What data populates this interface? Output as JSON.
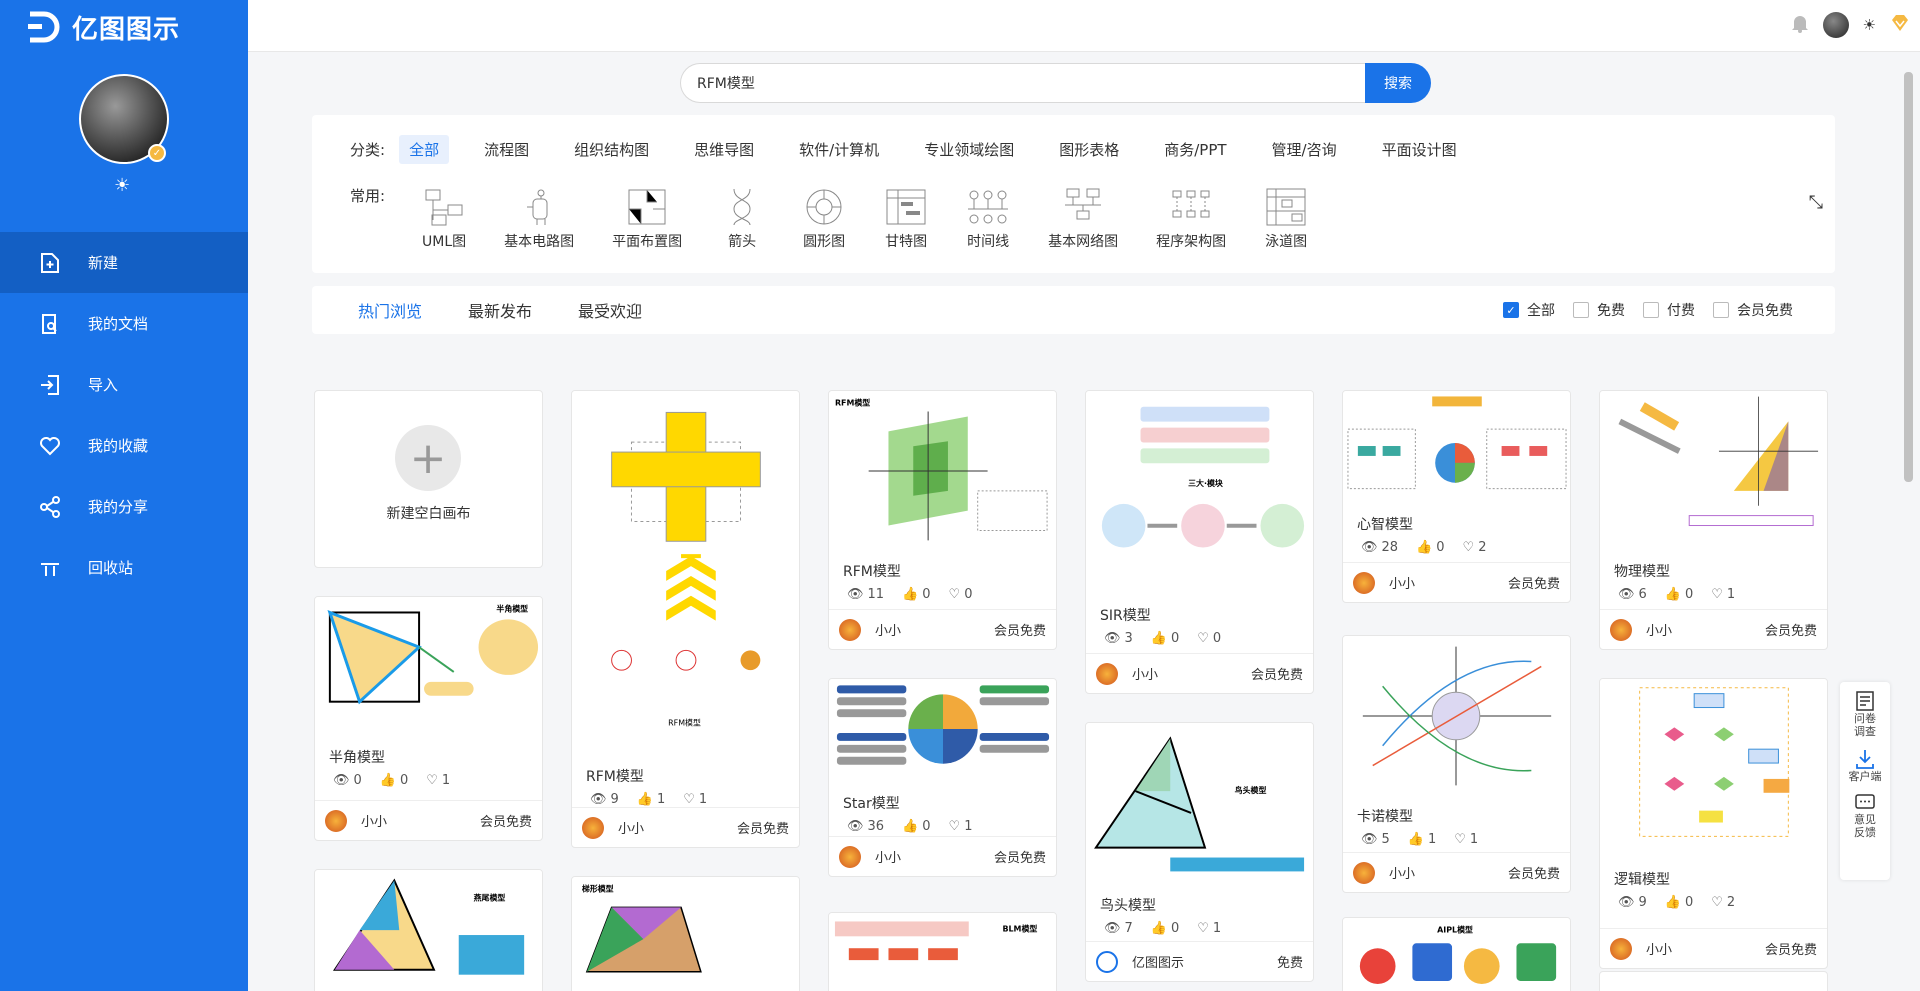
{
  "app": {
    "name": "亿图图示"
  },
  "sidebar": {
    "items": [
      {
        "label": "新建",
        "icon": "new-file-icon",
        "active": true
      },
      {
        "label": "我的文档",
        "icon": "documents-icon"
      },
      {
        "label": "导入",
        "icon": "import-icon"
      },
      {
        "label": "我的收藏",
        "icon": "heart-icon"
      },
      {
        "label": "我的分享",
        "icon": "share-icon"
      },
      {
        "label": "回收站",
        "icon": "trash-icon"
      }
    ]
  },
  "search": {
    "value": "RFM模型",
    "button": "搜索"
  },
  "categories": {
    "label": "分类:",
    "items": [
      "全部",
      "流程图",
      "组织结构图",
      "思维导图",
      "软件/计算机",
      "专业领域绘图",
      "图形表格",
      "商务/PPT",
      "管理/咨询",
      "平面设计图"
    ],
    "active": "全部"
  },
  "common": {
    "label": "常用:",
    "items": [
      "UML图",
      "基本电路图",
      "平面布置图",
      "箭头",
      "圆形图",
      "甘特图",
      "时间线",
      "基本网络图",
      "程序架构图",
      "泳道图"
    ]
  },
  "tabs": {
    "items": [
      "热门浏览",
      "最新发布",
      "最受欢迎"
    ],
    "active": "热门浏览"
  },
  "filters": [
    {
      "label": "全部",
      "checked": true
    },
    {
      "label": "免费",
      "checked": false
    },
    {
      "label": "付费",
      "checked": false
    },
    {
      "label": "会员免费",
      "checked": false
    }
  ],
  "blank": {
    "label": "新建空白画布"
  },
  "cards": {
    "banjiao": {
      "title": "半角模型",
      "views": "0",
      "likes": "0",
      "favs": "1",
      "author": "小小",
      "price": "会员免费"
    },
    "rfm1": {
      "title": "RFM模型",
      "views": "9",
      "likes": "1",
      "favs": "1",
      "author": "小小",
      "price": "会员免费"
    },
    "rfm2": {
      "title": "RFM模型",
      "views": "11",
      "likes": "0",
      "favs": "0",
      "author": "小小",
      "price": "会员免费"
    },
    "star": {
      "title": "Star模型",
      "views": "36",
      "likes": "0",
      "favs": "1",
      "author": "小小",
      "price": "会员免费"
    },
    "sir": {
      "title": "SIR模型",
      "views": "3",
      "likes": "0",
      "favs": "0",
      "author": "小小",
      "price": "会员免费"
    },
    "niaotou": {
      "title": "鸟头模型",
      "views": "7",
      "likes": "0",
      "favs": "1",
      "author": "亿图图示",
      "price": "免费"
    },
    "xinzhi": {
      "title": "心智模型",
      "views": "28",
      "likes": "0",
      "favs": "2",
      "author": "小小",
      "price": "会员免费"
    },
    "kanuo": {
      "title": "卡诺模型",
      "views": "5",
      "likes": "1",
      "favs": "1",
      "author": "小小",
      "price": "会员免费"
    },
    "wuli": {
      "title": "物理模型",
      "views": "6",
      "likes": "0",
      "favs": "1",
      "author": "小小",
      "price": "会员免费"
    },
    "luoji": {
      "title": "逻辑模型",
      "views": "9",
      "likes": "0",
      "favs": "2",
      "author": "小小",
      "price": "会员免费"
    }
  },
  "thumb_text": {
    "banjiao": "半角模型",
    "rfm_caption": "RFM模型",
    "rfm_small": "RFM模型",
    "sir_head": "三大·模块",
    "niaotou": "鸟头模型",
    "yanwei": "燕尾模型",
    "tixing": "梯形模型",
    "blm": "BLM模型",
    "aipl": "AIPL模型"
  },
  "float_panel": {
    "survey": "问卷调查",
    "client": "客户端",
    "feedback": "意见反馈"
  },
  "colors": {
    "primary": "#1a73e8",
    "sidebar": "#1a73e8"
  }
}
